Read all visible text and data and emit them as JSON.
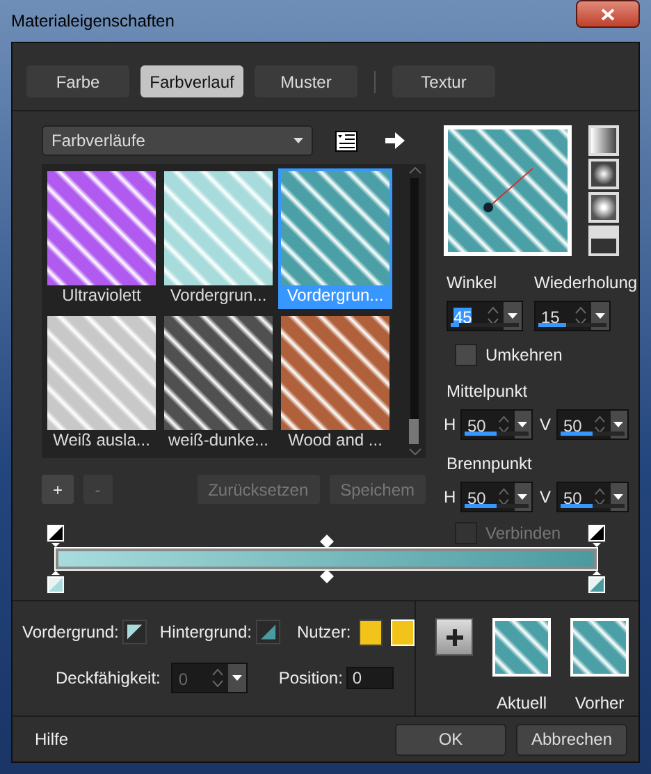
{
  "window": {
    "title": "Materialeigenschaften"
  },
  "tabs": [
    {
      "label": "Farbe",
      "selected": false
    },
    {
      "label": "Farbverlauf",
      "selected": true
    },
    {
      "label": "Muster",
      "selected": false
    },
    {
      "label": "Textur",
      "selected": false
    }
  ],
  "library": {
    "dropdown": {
      "value": "Farbverläufe"
    },
    "gallery": [
      {
        "label": "Ultraviolett",
        "color": "#b05af0",
        "selected": false
      },
      {
        "label": "Vordergrun...",
        "color": "#a8dcdc",
        "selected": false
      },
      {
        "label": "Vordergrun...",
        "color": "#4aa0a6",
        "selected": true
      },
      {
        "label": "Weiß ausla...",
        "color": "#c8c8c8",
        "selected": false
      },
      {
        "label": "weiß-dunke...",
        "color": "#505050",
        "selected": false
      },
      {
        "label": "Wood and ...",
        "color": "#b0603a",
        "selected": false
      }
    ],
    "buttons": [
      {
        "label": "+",
        "disabled": false
      },
      {
        "label": "-",
        "disabled": true
      },
      {
        "label": "Zurücksetzen",
        "disabled": true
      },
      {
        "label": "Speichem",
        "disabled": true
      }
    ]
  },
  "properties": {
    "angle": {
      "label": "Winkel",
      "value": "45",
      "level": 0.12
    },
    "repeat": {
      "label": "Wiederholung",
      "value": "15",
      "level": 0.4
    },
    "reverse": {
      "label": "Umkehren",
      "checked": false,
      "disabled": false
    },
    "center": {
      "label": "Mittelpunkt",
      "fields": [
        {
          "axis": "H",
          "value": "50",
          "level": 0.5
        },
        {
          "axis": "V",
          "value": "50",
          "level": 0.5
        }
      ]
    },
    "focus": {
      "label": "Brennpunkt",
      "fields": [
        {
          "axis": "H",
          "value": "50",
          "level": 0.5
        },
        {
          "axis": "V",
          "value": "50",
          "level": 0.5
        }
      ]
    },
    "link": {
      "label": "Verbinden",
      "checked": false,
      "disabled": true
    }
  },
  "colors": {
    "foreground_label": "Vordergrund:",
    "background_label": "Hintergrund:",
    "user_label": "Nutzer:",
    "user_swatches": [
      {
        "color": "#f2c318"
      },
      {
        "color": "#f2c318"
      }
    ],
    "opacity": {
      "label": "Deckfähigkeit:",
      "value": "0",
      "disabled": true
    },
    "position": {
      "label": "Position:",
      "value": "0"
    }
  },
  "previews": [
    {
      "label": "Aktuell"
    },
    {
      "label": "Vorher"
    }
  ],
  "footer": {
    "help": "Hilfe",
    "buttons": [
      {
        "label": "OK"
      },
      {
        "label": "Abbrechen"
      }
    ]
  }
}
